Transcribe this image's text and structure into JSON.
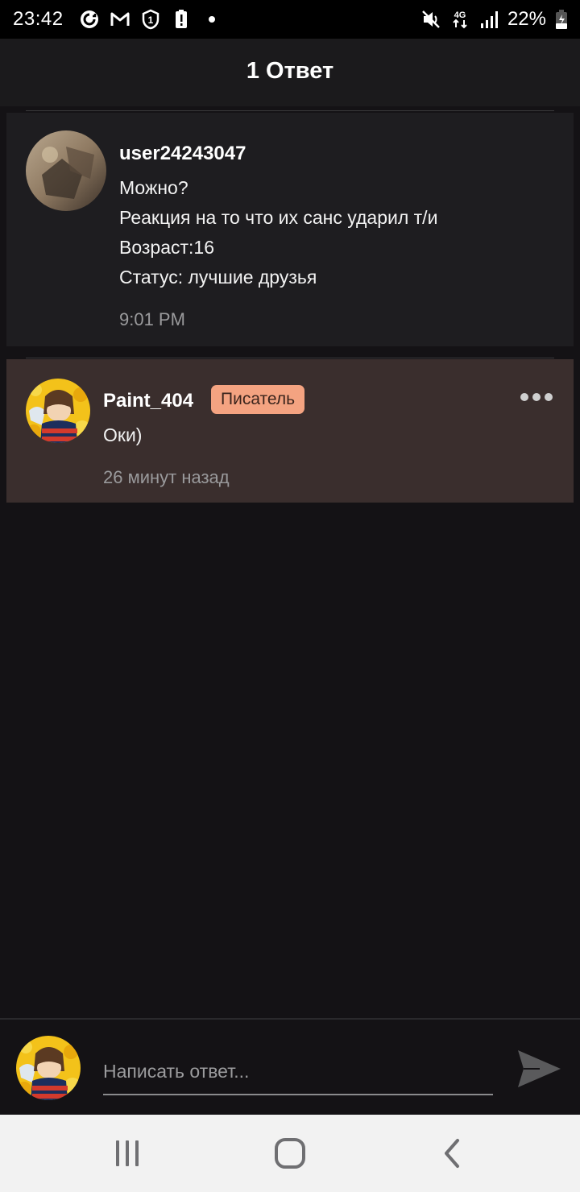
{
  "status_bar": {
    "time": "23:42",
    "battery": "22%",
    "network": "4G",
    "icons_left": [
      "sync-icon",
      "gmail-icon",
      "one-icon",
      "battery-alert-icon",
      "dot-icon"
    ],
    "icons_right": [
      "mute-icon",
      "network-4g-icon",
      "signal-icon",
      "battery-charging-icon"
    ]
  },
  "header": {
    "title": "1 Ответ"
  },
  "comment": {
    "username": "user24243047",
    "lines": [
      "Можно?",
      "Реакция на то что их санс ударил т/и",
      "Возраст:16",
      "Статус: лучшие друзья"
    ],
    "time": "9:01 PM"
  },
  "reply": {
    "username": "Paint_404",
    "badge": "Писатель",
    "text": "Оки)",
    "time": "26 минут назад"
  },
  "compose": {
    "placeholder": "Написать ответ..."
  },
  "colors": {
    "background": "#141215",
    "header": "#1b1a1c",
    "comment_card": "#1e1d20",
    "reply_card": "#3a2e2d",
    "badge": "#f4a381"
  }
}
